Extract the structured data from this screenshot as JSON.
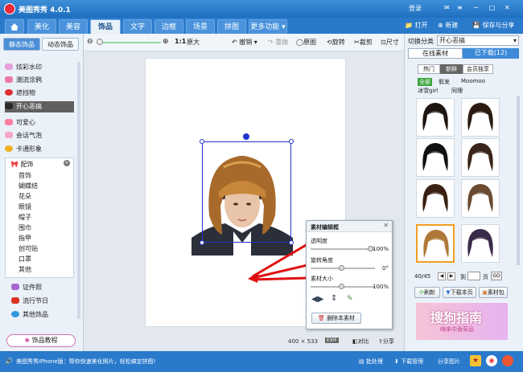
{
  "app": {
    "title": "美图秀秀 4.0.1",
    "login": "登录"
  },
  "tabs": [
    "美化",
    "美容",
    "饰品",
    "文字",
    "边框",
    "场景",
    "拼图",
    "更多功能"
  ],
  "top_actions": {
    "open": "打开",
    "new": "新建",
    "save": "保存与分享"
  },
  "toolbar": {
    "zoom_ratio": "1:1",
    "original_size": "原大",
    "undo": "撤销",
    "redo": "重做",
    "original": "原图",
    "rotate": "旋转",
    "crop": "裁剪",
    "resize": "尺寸"
  },
  "left": {
    "tab_static": "静态饰品",
    "tab_dynamic": "动态饰品",
    "items": [
      "炫彩水印",
      "潮流涂鸦",
      "遮挡物",
      "开心恶搞",
      "可爱心",
      "会话气泡",
      "卡通形象"
    ],
    "group": "配饰",
    "sub_items": [
      "首饰",
      "蝴蝶结",
      "花朵",
      "眼镜",
      "帽子",
      "围巾",
      "指甲",
      "创可贴",
      "口罩",
      "其他"
    ],
    "more": [
      "证件照",
      "流行节日",
      "其他饰品"
    ],
    "tutorial": "饰品教程"
  },
  "canvas": {
    "width": "400",
    "times": "×",
    "height": "533",
    "compare": "对比",
    "exif": "EXIF",
    "share": "分享"
  },
  "dialog": {
    "title": "素材编辑框",
    "opacity": "透明度",
    "opacity_value": "100%",
    "rotation": "旋转角度",
    "rotation_value": "0°",
    "size": "素材大小",
    "size_value": "100%",
    "delete": "删除本素材"
  },
  "right": {
    "category_label": "切换分类",
    "category_value": "开心恶搞",
    "online": "在线素材",
    "downloaded": "已下载(12)",
    "filters": [
      "热门",
      "新鲜",
      "会员独享"
    ],
    "subcats": [
      "全部",
      "假发",
      "Moomoo",
      "冰雪girl",
      "同理"
    ],
    "page_info": "40/45",
    "goto": "到",
    "page_unit": "页",
    "go": "GO",
    "refresh": "刷新",
    "download_page": "下载本页",
    "material_pack": "素材包"
  },
  "status": {
    "tip": "美图秀秀iPhone版：帮你快速美化照片，轻松搞定拼图!",
    "batch": "批处理",
    "download_mgr": "下载管理",
    "share_img": "分享图片"
  },
  "watermark": {
    "main": "搜狗指南",
    "sub": "嗨来中香草品"
  },
  "colors": {
    "titlebar": "#2a7acc",
    "accent": "#e8293b",
    "select_box": "#2233cc",
    "arrow": "#e01010"
  }
}
